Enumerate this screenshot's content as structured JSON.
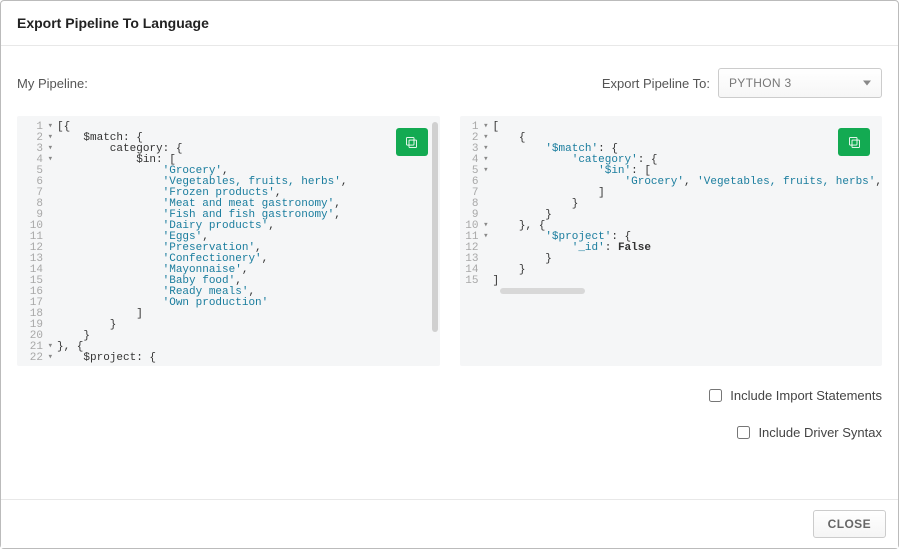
{
  "header": {
    "title": "Export Pipeline To Language"
  },
  "labels": {
    "my_pipeline": "My Pipeline:",
    "export_to": "Export Pipeline To:"
  },
  "dropdown": {
    "selected": "PYTHON 3"
  },
  "left_code": {
    "lines": [
      {
        "n": 1,
        "fold": true,
        "text": "[{"
      },
      {
        "n": 2,
        "fold": true,
        "text": "    $match: {"
      },
      {
        "n": 3,
        "fold": true,
        "text": "        category: {"
      },
      {
        "n": 4,
        "fold": true,
        "text": "            $in: ["
      },
      {
        "n": 5,
        "fold": false,
        "text": "                'Grocery',"
      },
      {
        "n": 6,
        "fold": false,
        "text": "                'Vegetables, fruits, herbs',"
      },
      {
        "n": 7,
        "fold": false,
        "text": "                'Frozen products',"
      },
      {
        "n": 8,
        "fold": false,
        "text": "                'Meat and meat gastronomy',"
      },
      {
        "n": 9,
        "fold": false,
        "text": "                'Fish and fish gastronomy',"
      },
      {
        "n": 10,
        "fold": false,
        "text": "                'Dairy products',"
      },
      {
        "n": 11,
        "fold": false,
        "text": "                'Eggs',"
      },
      {
        "n": 12,
        "fold": false,
        "text": "                'Preservation',"
      },
      {
        "n": 13,
        "fold": false,
        "text": "                'Confectionery',"
      },
      {
        "n": 14,
        "fold": false,
        "text": "                'Mayonnaise',"
      },
      {
        "n": 15,
        "fold": false,
        "text": "                'Baby food',"
      },
      {
        "n": 16,
        "fold": false,
        "text": "                'Ready meals',"
      },
      {
        "n": 17,
        "fold": false,
        "text": "                'Own production'"
      },
      {
        "n": 18,
        "fold": false,
        "text": "            ]"
      },
      {
        "n": 19,
        "fold": false,
        "text": "        }"
      },
      {
        "n": 20,
        "fold": false,
        "text": "    }"
      },
      {
        "n": 21,
        "fold": true,
        "text": "}, {"
      },
      {
        "n": 22,
        "fold": true,
        "text": "    $project: {"
      }
    ]
  },
  "right_code": {
    "lines": [
      {
        "n": 1,
        "fold": true,
        "text": "["
      },
      {
        "n": 2,
        "fold": true,
        "text": "    {"
      },
      {
        "n": 3,
        "fold": true,
        "text": "        '$match': {"
      },
      {
        "n": 4,
        "fold": true,
        "text": "            'category': {"
      },
      {
        "n": 5,
        "fold": true,
        "text": "                '$in': ["
      },
      {
        "n": 6,
        "fold": false,
        "text": "                    'Grocery', 'Vegetables, fruits, herbs',"
      },
      {
        "n": 7,
        "fold": false,
        "text": "                ]"
      },
      {
        "n": 8,
        "fold": false,
        "text": "            }"
      },
      {
        "n": 9,
        "fold": false,
        "text": "        }"
      },
      {
        "n": 10,
        "fold": true,
        "text": "    }, {"
      },
      {
        "n": 11,
        "fold": true,
        "text": "        '$project': {"
      },
      {
        "n": 12,
        "fold": false,
        "text": "            '_id': False"
      },
      {
        "n": 13,
        "fold": false,
        "text": "        }"
      },
      {
        "n": 14,
        "fold": false,
        "text": "    }"
      },
      {
        "n": 15,
        "fold": false,
        "text": "]"
      }
    ]
  },
  "checkboxes": {
    "include_imports": "Include Import Statements",
    "include_driver": "Include Driver Syntax"
  },
  "footer": {
    "close": "CLOSE"
  }
}
